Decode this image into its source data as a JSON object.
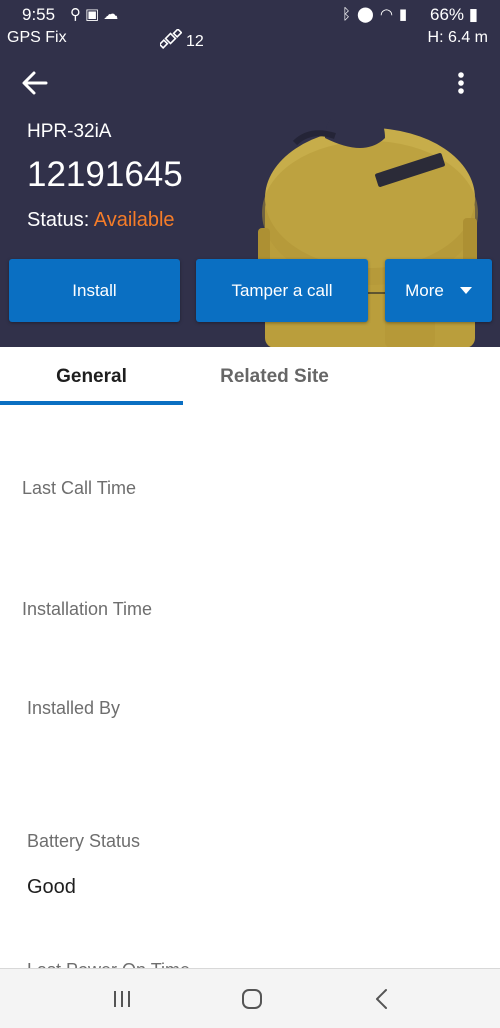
{
  "status_bar": {
    "time": "9:55",
    "battery_percent": "66%",
    "left_icons": [
      "usb-icon",
      "image-icon",
      "cloud-icon"
    ],
    "right_icons": [
      "bluetooth-icon",
      "location-icon",
      "wifi-icon",
      "signal-icon",
      "battery-icon"
    ]
  },
  "gps_bar": {
    "fix_label": "GPS Fix",
    "satellite_count": "12",
    "height": "H: 6.4 m"
  },
  "device": {
    "model": "HPR-32iA",
    "serial": "12191645",
    "status_label": "Status: ",
    "status_value": "Available"
  },
  "actions": {
    "install": "Install",
    "tamper": "Tamper a call",
    "more": "More"
  },
  "tabs": [
    {
      "label": "General",
      "active": true
    },
    {
      "label": "Related Site",
      "active": false
    }
  ],
  "fields": {
    "last_call_time": {
      "label": "Last Call Time",
      "value": ""
    },
    "installation_time": {
      "label": "Installation Time",
      "value": ""
    },
    "installed_by": {
      "label": "Installed By",
      "value": ""
    },
    "battery_status": {
      "label": "Battery Status",
      "value": "Good"
    },
    "next_field_partial": "Last Power On Time"
  },
  "colors": {
    "header_bg": "#31314a",
    "accent_blue": "#0a6fc2",
    "status_orange": "#f57c28"
  }
}
